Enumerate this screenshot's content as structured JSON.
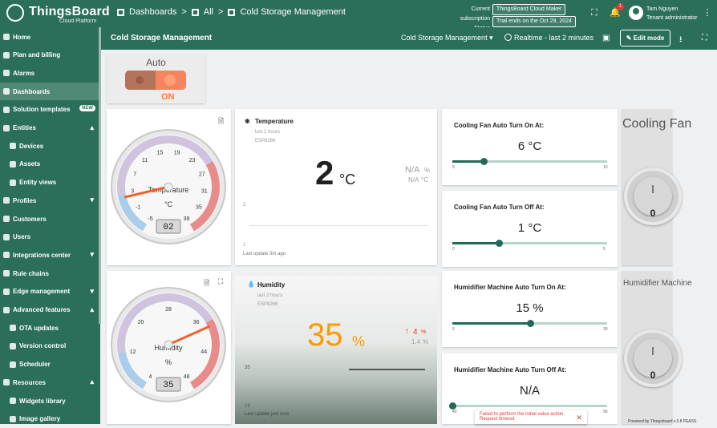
{
  "brand": {
    "name": "ThingsBoard",
    "tagline": "Cloud Platform"
  },
  "breadcrumb": [
    "Dashboards",
    "All",
    "Cold Storage Management"
  ],
  "subscription": {
    "label_current": "Current subscription",
    "value_current": "ThingsBoard Cloud Maker",
    "label_status": "Status",
    "value_status": "Trial ends on the Oct 29, 2024"
  },
  "notifications": {
    "count": "1"
  },
  "user": {
    "name": "Tam Nguyen",
    "role": "Tenant administrator"
  },
  "sidebar": {
    "items": [
      {
        "label": "Home"
      },
      {
        "label": "Plan and billing"
      },
      {
        "label": "Alarms"
      },
      {
        "label": "Dashboards"
      },
      {
        "label": "Solution templates",
        "badge": "NEW"
      },
      {
        "label": "Entities"
      },
      {
        "label": "Devices"
      },
      {
        "label": "Assets"
      },
      {
        "label": "Entity views"
      },
      {
        "label": "Profiles"
      },
      {
        "label": "Customers"
      },
      {
        "label": "Users"
      },
      {
        "label": "Integrations center"
      },
      {
        "label": "Rule chains"
      },
      {
        "label": "Edge management"
      },
      {
        "label": "Advanced features"
      },
      {
        "label": "OTA updates"
      },
      {
        "label": "Version control"
      },
      {
        "label": "Scheduler"
      },
      {
        "label": "Resources"
      },
      {
        "label": "Widgets library"
      },
      {
        "label": "Image gallery"
      }
    ]
  },
  "dashboard": {
    "title": "Cold Storage Management",
    "state": "Cold Storage Management",
    "timewindow": "Realtime - last 2 minutes",
    "edit_label": "Edit mode"
  },
  "auto_switch": {
    "label": "Auto",
    "state": "ON"
  },
  "temp_gauge": {
    "label": "Temperature",
    "unit": "°C",
    "value": "02",
    "ticks": [
      "-5",
      "-1",
      "3",
      "7",
      "11",
      "15",
      "19",
      "23",
      "27",
      "31",
      "35",
      "39"
    ]
  },
  "humidity_gauge": {
    "label": "Humidity",
    "unit": "%",
    "value": "35",
    "ticks": [
      "4",
      "12",
      "20",
      "28",
      "36",
      "44",
      "48"
    ]
  },
  "temp_card": {
    "title": "Temperature",
    "period": "last 2 hours",
    "device": "ESP8266",
    "value": "2",
    "unit": "°C",
    "delta": "N/A",
    "delta_unit": "%",
    "delta2": "N/A",
    "delta2_unit": "°C",
    "chart_top": "2",
    "chart_bottom": "1",
    "updated": "Last update 3m ago"
  },
  "humidity_card": {
    "title": "Humidity",
    "period": "last 2 hours",
    "device": "ESP8266",
    "value": "35",
    "unit": "%",
    "delta": "4",
    "delta_unit": "%",
    "delta2": "1.4",
    "delta2_unit": "%",
    "chart_top": "35",
    "chart_bottom": "18",
    "updated": "Last update just now"
  },
  "sliders": [
    {
      "title": "Cooling Fan Auto Turn On At:",
      "value": "6 °C",
      "min": "5",
      "max": "10",
      "fraction": 0.2
    },
    {
      "title": "Cooling Fan Auto Turn Off At:",
      "value": "1 °C",
      "min": "0",
      "max": "5",
      "fraction": 0.3
    },
    {
      "title": "Humidifier Machine Auto Turn On At:",
      "value": "15 %",
      "min": "5",
      "max": "30",
      "fraction": 0.5
    },
    {
      "title": "Humidifier Machine Auto Turn Off At:",
      "value": "N/A",
      "min": "40",
      "max": "90",
      "fraction": 0
    }
  ],
  "cooling_fan": {
    "title": "Cooling Fan",
    "value": "0"
  },
  "humidifier": {
    "title": "Humidifier Machine",
    "value": "0"
  },
  "error": {
    "text": "Failed to perform the initial value action. Request timeout"
  },
  "footer": {
    "powered": "Powered by Thingsboard v.3.8 PE&SS"
  },
  "colors": {
    "primary": "#2b6f5a",
    "accent": "#ff9800",
    "switch_on": "#f4855e"
  }
}
